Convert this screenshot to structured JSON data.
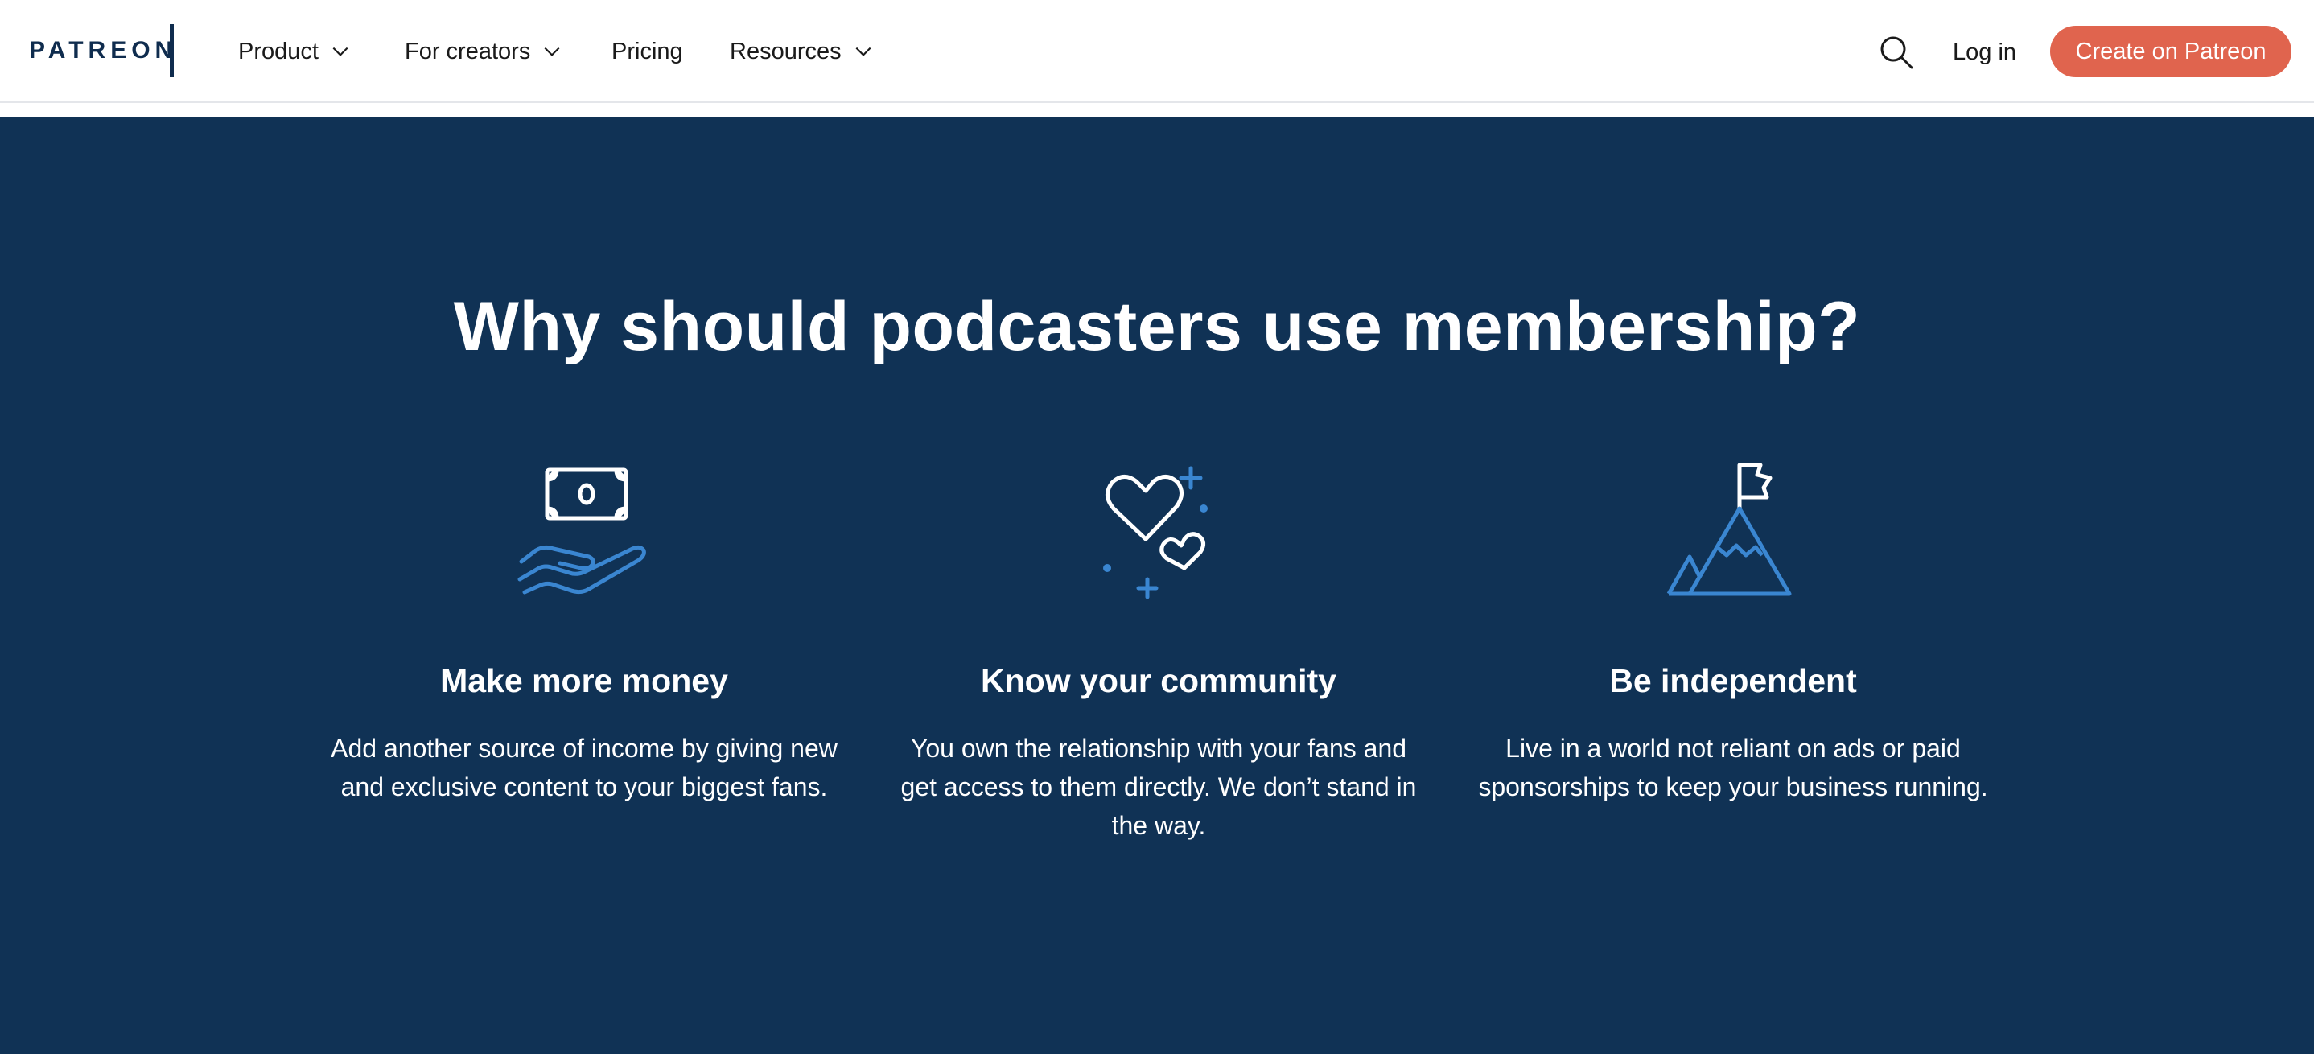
{
  "header": {
    "logo": "PATREON",
    "nav": [
      {
        "label": "Product",
        "has_dropdown": true
      },
      {
        "label": "For creators",
        "has_dropdown": true
      },
      {
        "label": "Pricing",
        "has_dropdown": false
      },
      {
        "label": "Resources",
        "has_dropdown": true
      }
    ],
    "search_icon": "search-icon",
    "login_label": "Log in",
    "cta_label": "Create on Patreon"
  },
  "why": {
    "title": "Why should podcasters use membership?",
    "features": [
      {
        "icon": "money-in-hand-icon",
        "heading": "Make more money",
        "text": "Add another source of income by giving new and exclusive content to your biggest fans."
      },
      {
        "icon": "hearts-icon",
        "heading": "Know your community",
        "text": "You own the relationship with your fans and get access to them directly. We don’t stand in the way."
      },
      {
        "icon": "mountain-flag-icon",
        "heading": "Be independent",
        "text": "Live in a world not reliant on ads or paid sponsorships to keep your business running."
      }
    ]
  },
  "colors": {
    "brand_navy": "#103255",
    "cta_coral": "#e0644e",
    "icon_white": "#ffffff",
    "icon_blue": "#3a86d1"
  }
}
